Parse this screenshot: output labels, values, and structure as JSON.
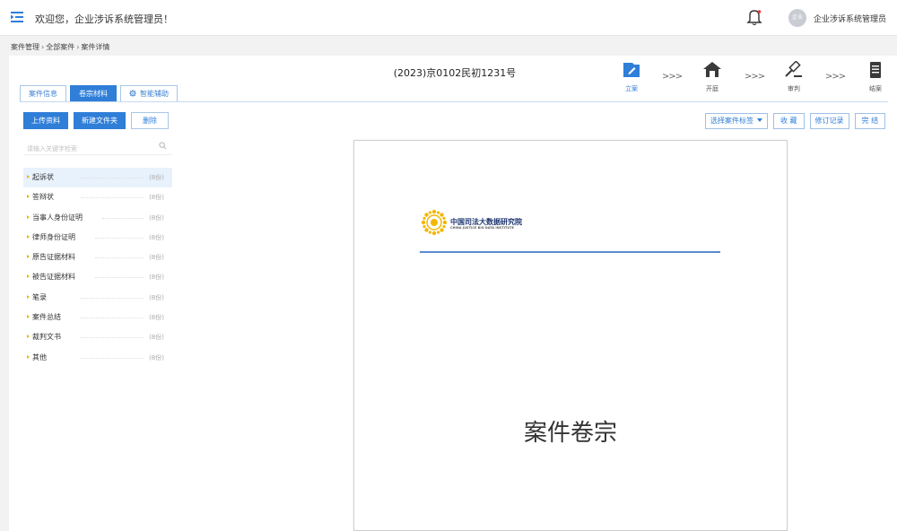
{
  "header": {
    "welcome": "欢迎您，企业涉诉系统管理员！",
    "avatar_text": "企业",
    "username": "企业涉诉系统管理员"
  },
  "breadcrumb": [
    "案件管理",
    "全部案件",
    "案件详情"
  ],
  "case": {
    "title": "(2023)京0102民初1231号"
  },
  "tabs": [
    {
      "label": "案件信息",
      "active": false
    },
    {
      "label": "卷宗材料",
      "active": true
    },
    {
      "label": "智能辅助",
      "active": false,
      "icon": "gear-icon"
    }
  ],
  "steps": [
    {
      "label": "立案",
      "icon": "edit-icon",
      "active": true
    },
    {
      "label": "开庭",
      "icon": "court-icon",
      "active": false
    },
    {
      "label": "审判",
      "icon": "gavel-icon",
      "active": false
    },
    {
      "label": "结案",
      "icon": "document-icon",
      "active": false
    }
  ],
  "step_separator": ">>>",
  "toolbar": {
    "upload_label": "上传资料",
    "new_folder_label": "新建文件夹",
    "delete_label": "删除"
  },
  "right_toolbar": {
    "select_tag_label": "选择案件标签",
    "favorite_label": "收 藏",
    "revision_label": "修订记录",
    "finish_label": "完 结"
  },
  "search": {
    "placeholder": "请输入关键字检索"
  },
  "folders": [
    {
      "label": "起诉状",
      "count": "(8份)",
      "selected": true
    },
    {
      "label": "答辩状",
      "count": "(8份)",
      "selected": false
    },
    {
      "label": "当事人身份证明",
      "count": "(8份)",
      "selected": false
    },
    {
      "label": "律师身份证明",
      "count": "(8份)",
      "selected": false
    },
    {
      "label": "原告证据材料",
      "count": "(8份)",
      "selected": false
    },
    {
      "label": "被告证据材料",
      "count": "(8份)",
      "selected": false
    },
    {
      "label": "笔录",
      "count": "(8份)",
      "selected": false
    },
    {
      "label": "案件总结",
      "count": "(8份)",
      "selected": false
    },
    {
      "label": "裁判文书",
      "count": "(8份)",
      "selected": false
    },
    {
      "label": "其他",
      "count": "(8份)",
      "selected": false
    }
  ],
  "document": {
    "org_cn": "中国司法大数据研究院",
    "org_en": "CHINA JUSTICE BIG DATA INSTITUTE",
    "title": "案件卷宗"
  },
  "colors": {
    "accent": "#2f7ed8",
    "folder_marker": "#f0b400",
    "logo_gold": "#f2b705",
    "logo_navy": "#1c3470"
  }
}
